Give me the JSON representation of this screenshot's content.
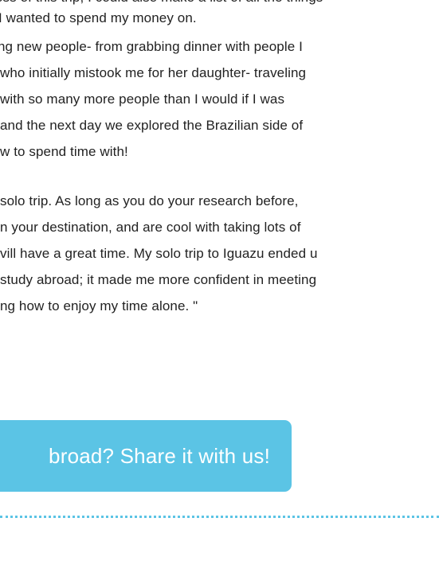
{
  "story": {
    "lines": [
      "ess of this trip, I could also make a list of all the things",
      "I wanted to spend my money on.",
      "ng new people- from grabbing dinner with people I",
      "who initially mistook me for her daughter- traveling",
      "with so many more people than I would if I was",
      "and the next day we explored the Brazilian side of",
      "w to spend time with!",
      "solo trip. As long as you do your research before,",
      "n your destination, and are cool with taking lots of",
      "vill have a great time. My solo trip to Iguazu ended u",
      "study abroad; it made me more confident in meeting",
      "ng how to enjoy my time alone. \""
    ]
  },
  "cta": {
    "label": "broad? Share it with us!"
  },
  "colors": {
    "accent": "#5bc4e5",
    "text": "#222222",
    "background": "#ffffff"
  }
}
